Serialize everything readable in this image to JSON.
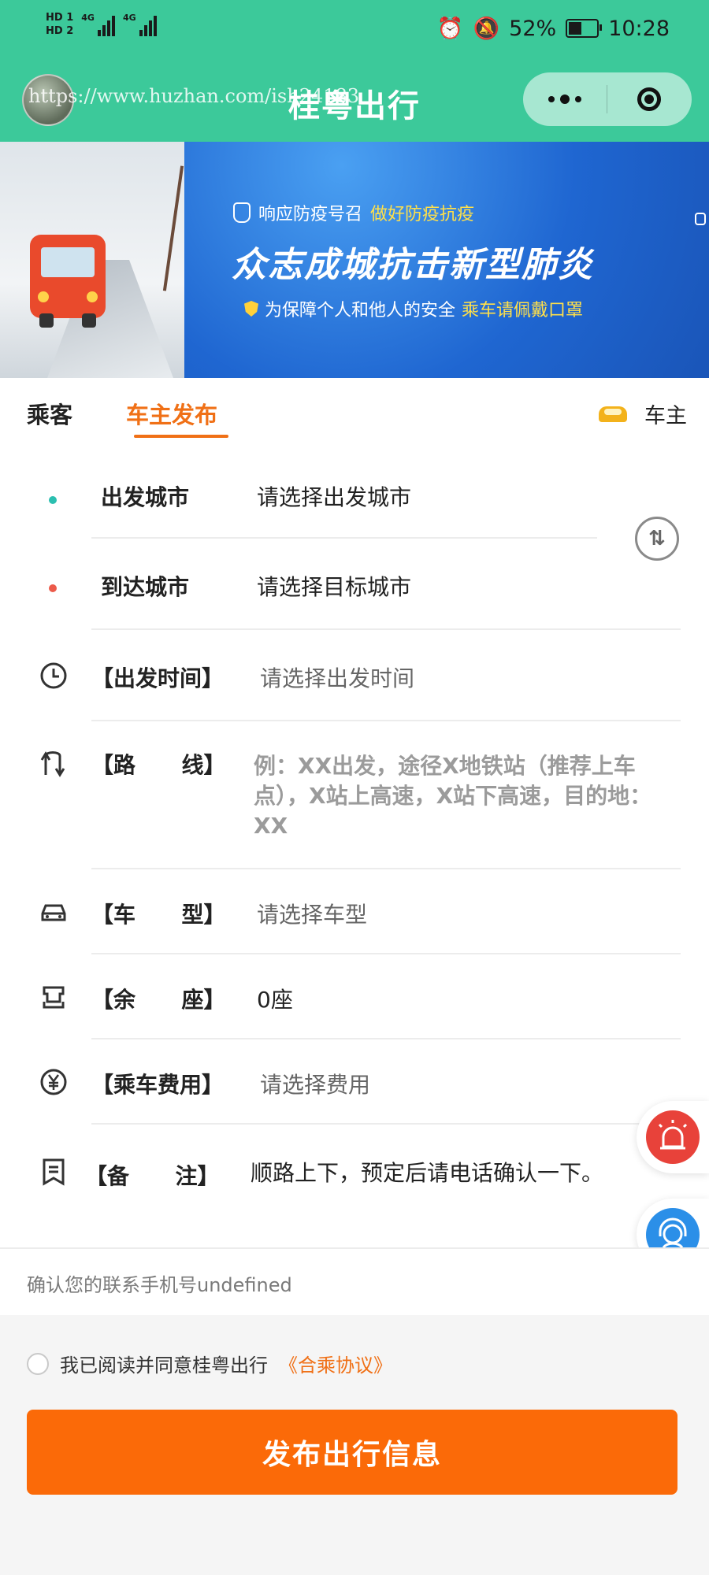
{
  "status_bar": {
    "hd1": "HD 1",
    "hd2": "HD 2",
    "net1": "4G",
    "net2": "4G",
    "battery": "52%",
    "battery_level": 0.52,
    "time": "10:28"
  },
  "header": {
    "title": "桂粤出行",
    "watermark": "https://www.huzhan.com/ish24183"
  },
  "banner": {
    "line1_prefix": "响应防疫号召",
    "line1_highlight": "做好防疫抗疫",
    "headline": "众志成城抗击新型肺炎",
    "line3_prefix": "为保障个人和他人的安全",
    "line3_highlight": "乘车请佩戴口罩"
  },
  "tabs": {
    "passenger": "乘客",
    "publish": "车主发布",
    "owner": "车主"
  },
  "form": {
    "departure_label": "出发城市",
    "departure_value": "请选择出发城市",
    "arrival_label": "到达城市",
    "arrival_value": "请选择目标城市",
    "time_label": "【出发时间】",
    "time_value": "请选择出发时间",
    "route_label": "【路      线】",
    "route_value": "例：XX出发，途径X地铁站（推荐上车点），X站上高速，X站下高速，目的地：XX",
    "model_label": "【车      型】",
    "model_value": "请选择车型",
    "seats_label": "【余      座】",
    "seats_value": "0座",
    "fee_label": "【乘车费用】",
    "fee_value": "请选择费用",
    "note_label": "【备      注】",
    "note_value": "顺路上下，预定后请电话确认一下。"
  },
  "contact": "确认您的联系手机号undefined",
  "agreement": {
    "text": "我已阅读并同意桂粤出行",
    "link": "《合乘协议》"
  },
  "submit_label": "发布出行信息",
  "colors": {
    "header_green": "#3cc99a",
    "accent_orange": "#f07016",
    "button_orange": "#fb6a08",
    "departure_dot": "#2bbfb0",
    "arrival_dot": "#ec5a4a",
    "alarm_red": "#e8423a",
    "service_blue": "#2b8fe8"
  }
}
